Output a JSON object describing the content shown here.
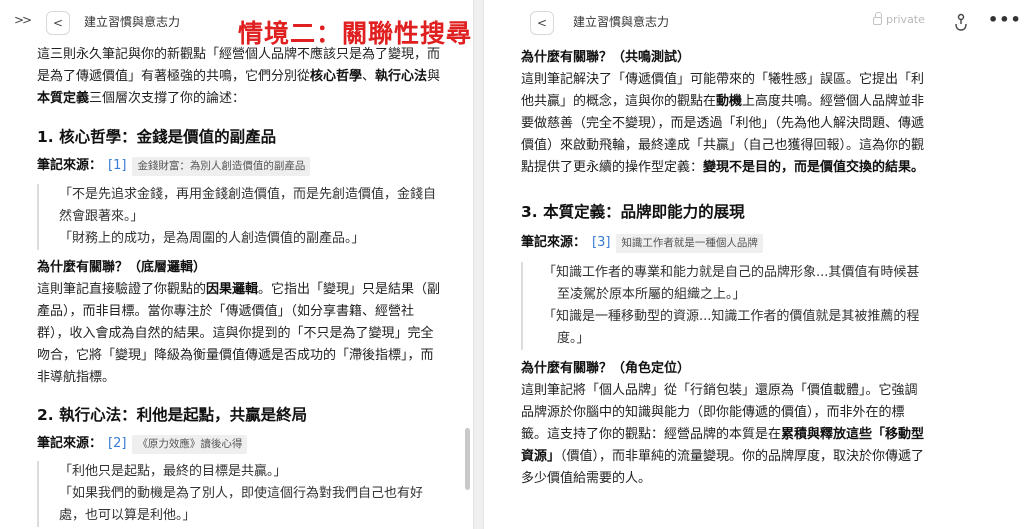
{
  "left": {
    "header": {
      "title": "建立習慣與意志力"
    },
    "intro": {
      "line1": "這三則永久筆記與你的新觀點「經營個人品牌不應該只是為了變現，而",
      "line2": "是為了傳遞價值」有著極強的共鳴，它們分別從",
      "kw1": "核心哲學",
      "sep1": "、",
      "kw2": "執行心法",
      "and": "與",
      "kw3": "本質定義",
      "line3_rest": "三個層次支撐了你的論述："
    },
    "section1": {
      "heading": "1. 核心哲學：金錢是價值的副產品",
      "source_label": "筆記來源：",
      "source_num": "[1]",
      "source_tag": "金錢財富：為別人創造價值的副產品",
      "quote1a": "「不是先追求金錢，再用金錢創造價值，而是先創造價值，金錢自",
      "quote1b": "然會跟著來。」",
      "quote2": "「財務上的成功，是為周圍的人創造價值的副產品。」",
      "why_heading": "為什麼有關聯？（底層邏輯）",
      "why_l1_pre": "這則筆記直接驗證了你觀點的",
      "why_l1_bold": "因果邏輯",
      "why_l1_post": "。它指出「變現」只是結果（副",
      "why_l2": "產品），而非目標。當你專注於「傳遞價值」（如分享書籍、經營社",
      "why_l3": "群），收入會成為自然的結果。這與你提到的「不只是為了變現」完全",
      "why_l4": "吻合，它將「變現」降級為衡量價值傳遞是否成功的「滯後指標」，而",
      "why_l5": "非導航指標。"
    },
    "section2": {
      "heading": "2. 執行心法：利他是起點，共贏是終局",
      "source_label": "筆記來源：",
      "source_num": "[2]",
      "source_tag": "《原力效應》讀後心得",
      "quote1": "「利他只是起點，最終的目標是共贏。」",
      "quote2a": "「如果我們的動機是為了別人，即使這個行為對我們自己也有好",
      "quote2b": "處，也可以算是利他。」"
    }
  },
  "overlay": {
    "title": "情境二：關聯性搜尋"
  },
  "right": {
    "header": {
      "title": "建立習慣與意志力",
      "private_label": "private"
    },
    "cont": {
      "why_heading": "為什麼有關聯？（共鳴測試）",
      "l1": "這則筆記解決了「傳遞價值」可能帶來的「犧牲感」誤區。它提出「利",
      "l2_pre": "他共贏」的概念，這與你的觀點在",
      "l2_bold": "動機",
      "l2_post": "上高度共鳴。經營個人品牌並非",
      "l3": "要做慈善（完全不變現），而是透過「利他」（先為他人解決問題、傳遞",
      "l4": "價值）來啟動飛輪，最終達成「共贏」（自己也獲得回報）。這為你的觀",
      "l5_pre": "點提供了更永續的操作型定義：",
      "l5_bold": "變現不是目的，而是價值交換的結果。"
    },
    "section3": {
      "heading": "3. 本質定義：品牌即能力的展現",
      "source_label": "筆記來源：",
      "source_num": "[3]",
      "source_tag": "知識工作者就是一種個人品牌",
      "quote1a": "「知識工作者的專業和能力就是自己的品牌形象...其價值有時候甚",
      "quote1b": "至凌駕於原本所屬的組織之上。」",
      "quote2a": "「知識是一種移動型的資源...知識工作者的價值就是其被推薦的程",
      "quote2b": "度。」",
      "why_heading": "為什麼有關聯？（角色定位）",
      "w1": "這則筆記將「個人品牌」從「行銷包裝」還原為「價值載體」。它強調",
      "w2": "品牌源於你腦中的知識與能力（即你能傳遞的價值），而非外在的標",
      "w3_pre": "籤。這支持了你的觀點：經營品牌的本質是在",
      "w3_bold": "累積與釋放這些「移動型",
      "w4_bold": "資源」",
      "w4_post": "（價值），而非單純的流量變現。你的品牌厚度，取決於你傳遞了",
      "w5": "多少價值給需要的人。"
    }
  }
}
